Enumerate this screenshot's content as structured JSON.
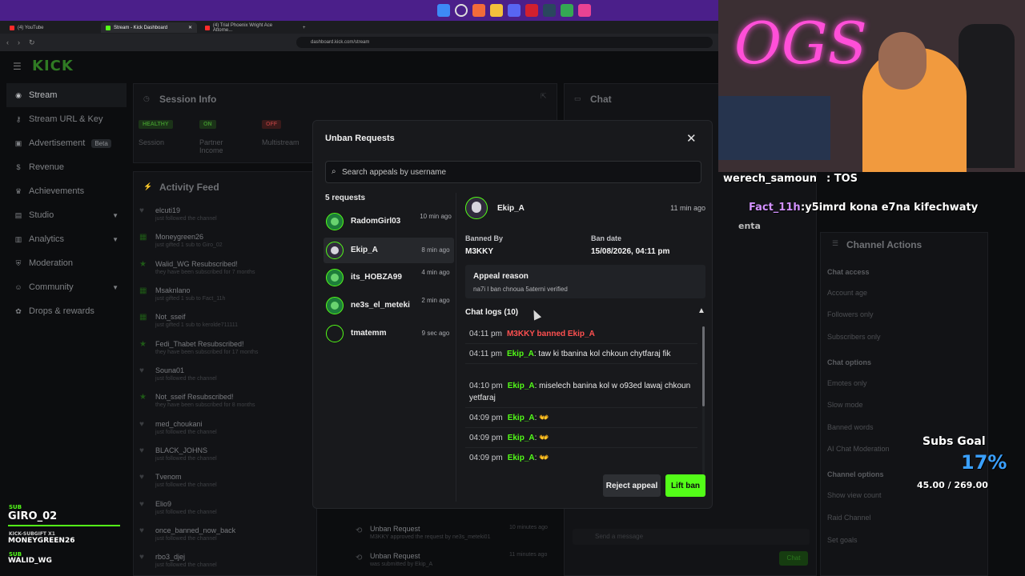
{
  "browser": {
    "tabs": [
      {
        "label": "(4) YouTube"
      },
      {
        "label": "Stream - Kick Dashboard"
      },
      {
        "label": "(4) Trial Phoenix Wright Ace Attorne..."
      }
    ],
    "url": "dashboard.kick.com/stream"
  },
  "app": {
    "logo": "KICK",
    "sidebar": [
      {
        "label": "Stream",
        "icon": "signal-icon"
      },
      {
        "label": "Stream URL & Key",
        "icon": "key-icon"
      },
      {
        "label": "Advertisement",
        "icon": "ad-icon",
        "badge": "Beta"
      },
      {
        "label": "Revenue",
        "icon": "dollar-icon"
      },
      {
        "label": "Achievements",
        "icon": "trophy-icon"
      },
      {
        "label": "Studio",
        "icon": "studio-icon"
      },
      {
        "label": "Analytics",
        "icon": "chart-icon"
      },
      {
        "label": "Moderation",
        "icon": "shield-icon"
      },
      {
        "label": "Community",
        "icon": "people-icon"
      },
      {
        "label": "Drops & rewards",
        "icon": "gift-icon"
      }
    ],
    "session": {
      "title": "Session Info",
      "chips": [
        "HEALTHY",
        "ON",
        "OFF"
      ],
      "labels": [
        "Session",
        "Partner Income",
        "Multistream"
      ]
    },
    "activity": {
      "title": "Activity Feed",
      "items": [
        {
          "name": "elcuti19",
          "sub": "just followed the channel"
        },
        {
          "name": "Moneygreen26",
          "sub": "just gifted 1 sub to Giro_02"
        },
        {
          "name": "Walid_WG Resubscribed!",
          "sub": "they have been subscribed for 7 months"
        },
        {
          "name": "Msaknlano",
          "sub": "just gifted 1 sub to Fact_11h"
        },
        {
          "name": "Not_sseif",
          "sub": "just gifted 1 sub to kerolde711111"
        },
        {
          "name": "Fedi_Thabet Resubscribed!",
          "sub": "they have been subscribed for 17 months"
        },
        {
          "name": "Souna01",
          "sub": "just followed the channel"
        },
        {
          "name": "Not_sseif Resubscribed!",
          "sub": "they have been subscribed for 8 months"
        },
        {
          "name": "med_choukani",
          "sub": "just followed the channel"
        },
        {
          "name": "BLACK_JOHNS",
          "sub": "just followed the channel"
        },
        {
          "name": "Tvenom",
          "sub": "just followed the channel"
        },
        {
          "name": "Elio9",
          "sub": "just followed the channel"
        },
        {
          "name": "once_banned_now_back",
          "sub": "just followed the channel"
        },
        {
          "name": "rbo3_djej",
          "sub": "just followed the channel"
        }
      ]
    },
    "chat": {
      "title": "Chat",
      "placeholder": "Send a message",
      "send": "Chat"
    },
    "channel_actions": {
      "title": "Channel Actions",
      "chat_access": "Chat access",
      "rows": [
        "Account age",
        "Followers only",
        "Subscribers only"
      ],
      "chat_options": "Chat options",
      "opt_rows": [
        "Emotes only",
        "Slow mode",
        "Banned words",
        "AI Chat Moderation"
      ],
      "channel_options": "Channel options",
      "ch_rows": [
        "Show view count",
        "Raid Channel",
        "Set goals"
      ]
    },
    "mod_items": [
      {
        "title": "Unban Request",
        "sub": "M3KKY approved the request by ne3s_meteki01",
        "time": "10 minutes ago"
      },
      {
        "title": "Unban Request",
        "sub": "was submitted by Ekip_A",
        "time": "11 minutes ago"
      }
    ]
  },
  "overlay": {
    "chat1_user": "werech_samoun",
    "chat1_text": ": TOS",
    "chat2_user": "Fact_11h",
    "chat2_text": ":y5imrd kona e7na kifechwaty",
    "chat2_cont": "enta",
    "subs_goal_label": "Subs Goal",
    "subs_goal_pct": "17%",
    "subs_goal_value": "45.00 / 269.00",
    "sub_label": "SUB",
    "sub_name": "GIRO_02",
    "subgift": "KICK-SUBGIFT X1",
    "subgift_name": "MONEYGREEN26",
    "sub2_label": "SUB",
    "sub2_name": "WALID_WG",
    "subs_goal_progress": 0.17
  },
  "modal": {
    "title": "Unban Requests",
    "search_placeholder": "Search appeals by username",
    "count": "5 requests",
    "requests": [
      {
        "username": "RadomGirl03",
        "time": "10 min ago"
      },
      {
        "username": "Ekip_A",
        "time": "8 min ago"
      },
      {
        "username": "its_HOBZA99",
        "time": "4 min ago"
      },
      {
        "username": "ne3s_el_meteki",
        "time": "2 min ago"
      },
      {
        "username": "tmatemm",
        "time": "9 sec ago"
      }
    ],
    "detail": {
      "username": "Ekip_A",
      "time": "11 min ago",
      "banned_by_label": "Banned By",
      "banned_by": "M3KKY",
      "ban_date_label": "Ban date",
      "ban_date": "15/08/2026, 04:11 pm",
      "appeal_label": "Appeal reason",
      "appeal_text": "na7i l ban chnoua 5aterni verified",
      "logs_label": "Chat logs (10)",
      "logs": [
        {
          "time": "04:11 pm",
          "kind": "ban",
          "text": "M3KKY banned Ekip_A"
        },
        {
          "time": "04:11 pm",
          "kind": "msg",
          "user": "Ekip_A",
          "text": "taw ki tbanina kol chkoun chytfaraj fik"
        },
        {
          "time": "04:10 pm",
          "kind": "msg",
          "user": "Ekip_A",
          "text": "miselech banina kol w o93ed lawaj chkoun yetfaraj"
        },
        {
          "time": "04:09 pm",
          "kind": "msg",
          "user": "Ekip_A",
          "text": "👐"
        },
        {
          "time": "04:09 pm",
          "kind": "msg",
          "user": "Ekip_A",
          "text": "👐"
        },
        {
          "time": "04:09 pm",
          "kind": "msg",
          "user": "Ekip_A",
          "text": "👐"
        }
      ]
    },
    "reject_label": "Reject appeal",
    "lift_label": "Lift ban"
  },
  "colors": {
    "accent": "#53fc18",
    "ban": "#ff5050",
    "modal_bg": "#18191c"
  }
}
